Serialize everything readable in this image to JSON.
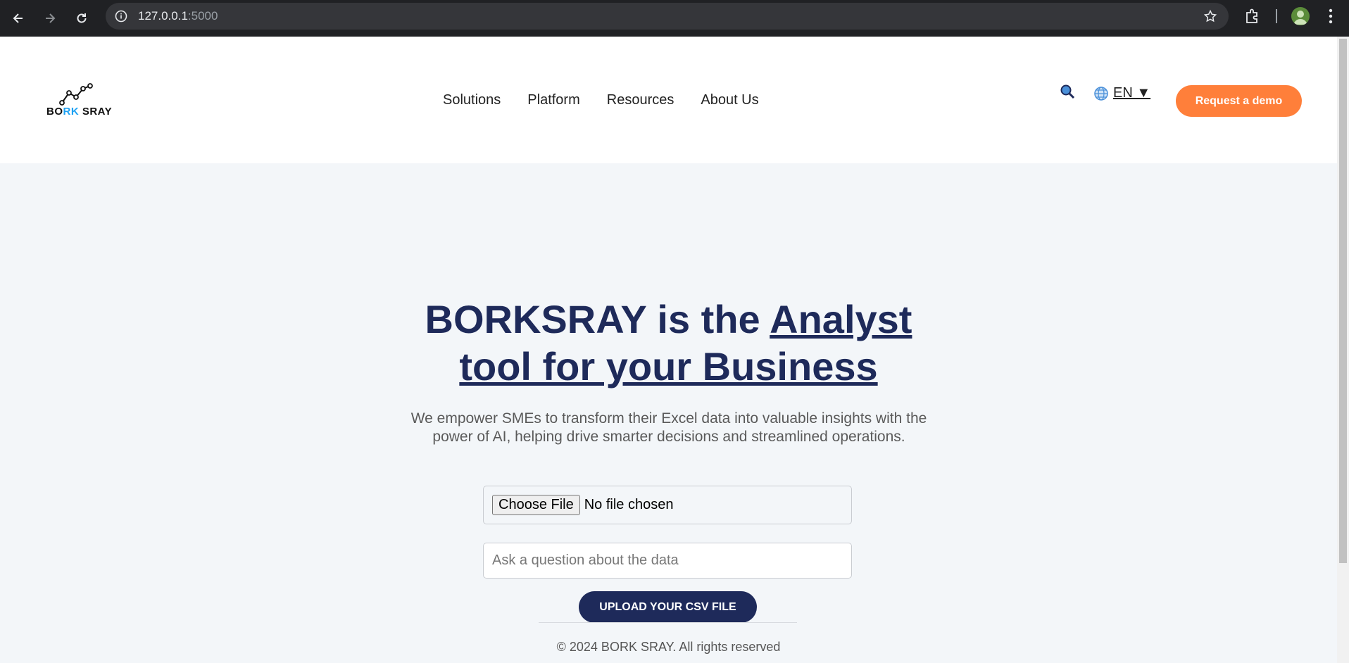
{
  "browser": {
    "url_host": "127.0.0.1",
    "url_port": ":5000"
  },
  "site": {
    "logo": {
      "text_part1": "BO",
      "text_blue": "RK",
      "text_part2": " SRAY"
    },
    "nav": [
      "Solutions",
      "Platform",
      "Resources",
      "About Us"
    ],
    "search_icon": "search-icon",
    "language": {
      "icon": "globe-icon",
      "label": "EN ▼"
    },
    "demo_button": "Request a demo"
  },
  "hero": {
    "headline_plain": "BORKSRAY is the ",
    "headline_underlined_1": "Analyst",
    "headline_underlined_2": "tool for your Business",
    "subtitle": "We empower SMEs to transform their Excel data into valuable insights with the power of AI, helping drive smarter decisions and streamlined operations.",
    "file_button": "Choose File",
    "file_status": "No file chosen",
    "question_placeholder": "Ask a question about the data",
    "upload_button": "UPLOAD YOUR CSV FILE",
    "footer": "© 2024 BORK SRAY. All rights reserved"
  },
  "colors": {
    "navy": "#1e2a5a",
    "orange": "#ff7f3a",
    "background": "#f3f6f9"
  }
}
